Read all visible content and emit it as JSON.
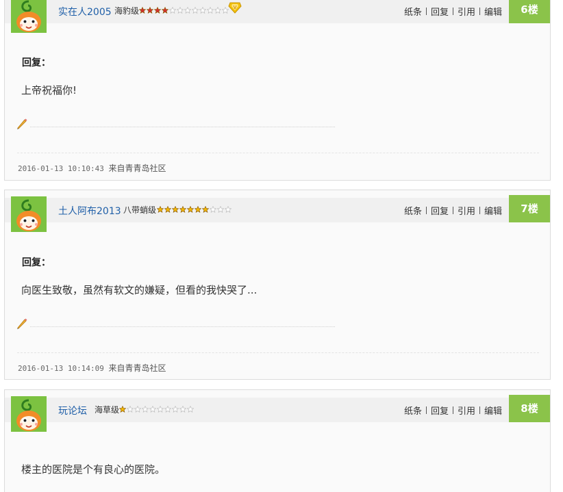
{
  "actions": [
    "纸条",
    "回复",
    "引用",
    "编辑"
  ],
  "posts": [
    {
      "username": "实在人2005",
      "level": "海豹级",
      "stars_filled": 4,
      "stars_total": 12,
      "star_color": "#d32f2f",
      "has_vip_badge": true,
      "floor": "6楼",
      "reply_label": "回复：",
      "content": "上帝祝福你!",
      "timestamp": "2016-01-13 10:10:43",
      "source": "来自青青岛社区"
    },
    {
      "username": "土人阿布2013",
      "level": "八带蛸级",
      "stars_filled": 7,
      "stars_total": 10,
      "star_color": "#f5b800",
      "has_vip_badge": false,
      "floor": "7楼",
      "reply_label": "回复：",
      "content": "向医生致敬，虽然有软文的嫌疑，但看的我快哭了...",
      "timestamp": "2016-01-13 10:14:09",
      "source": "来自青青岛社区"
    },
    {
      "username": "玩论坛",
      "level": "海草级",
      "stars_filled": 1,
      "stars_total": 10,
      "star_color": "#f5b800",
      "has_vip_badge": false,
      "floor": "8楼",
      "content": "楼主的医院是个有良心的医院。"
    }
  ],
  "colors": {
    "floor_badge": "#8bc34a",
    "username": "#1f5fa8",
    "avatar_bg": "#7cc241"
  },
  "icons": [
    "avatar-icon",
    "star-icon",
    "vip-diamond-icon",
    "pencil-icon"
  ]
}
